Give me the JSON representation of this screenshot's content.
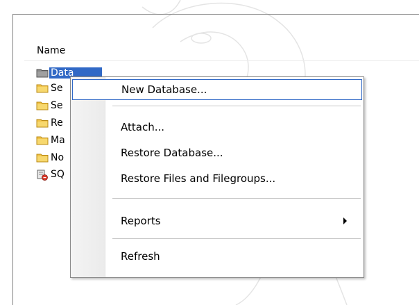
{
  "window": {
    "column_header": "Name"
  },
  "tree": {
    "items": [
      {
        "label": "Data",
        "icon": "folder-gray-icon",
        "selected": true
      },
      {
        "label": "Se",
        "icon": "folder-icon"
      },
      {
        "label": "Se",
        "icon": "folder-icon"
      },
      {
        "label": "Re",
        "icon": "folder-icon"
      },
      {
        "label": "Ma",
        "icon": "folder-icon"
      },
      {
        "label": "No",
        "icon": "folder-icon"
      },
      {
        "label": "SQ",
        "icon": "sql-agent-stopped-icon"
      }
    ]
  },
  "context_menu": {
    "items": [
      {
        "label": "New Database...",
        "highlighted": true
      },
      {
        "label": "Attach..."
      },
      {
        "label": "Restore Database..."
      },
      {
        "label": "Restore Files and Filegroups..."
      },
      {
        "label": "Reports",
        "has_submenu": true
      },
      {
        "label": "Refresh"
      }
    ]
  },
  "colors": {
    "selection": "#3169c6",
    "folder": "#f2c44b",
    "folder_gray": "#8a8a8a"
  }
}
